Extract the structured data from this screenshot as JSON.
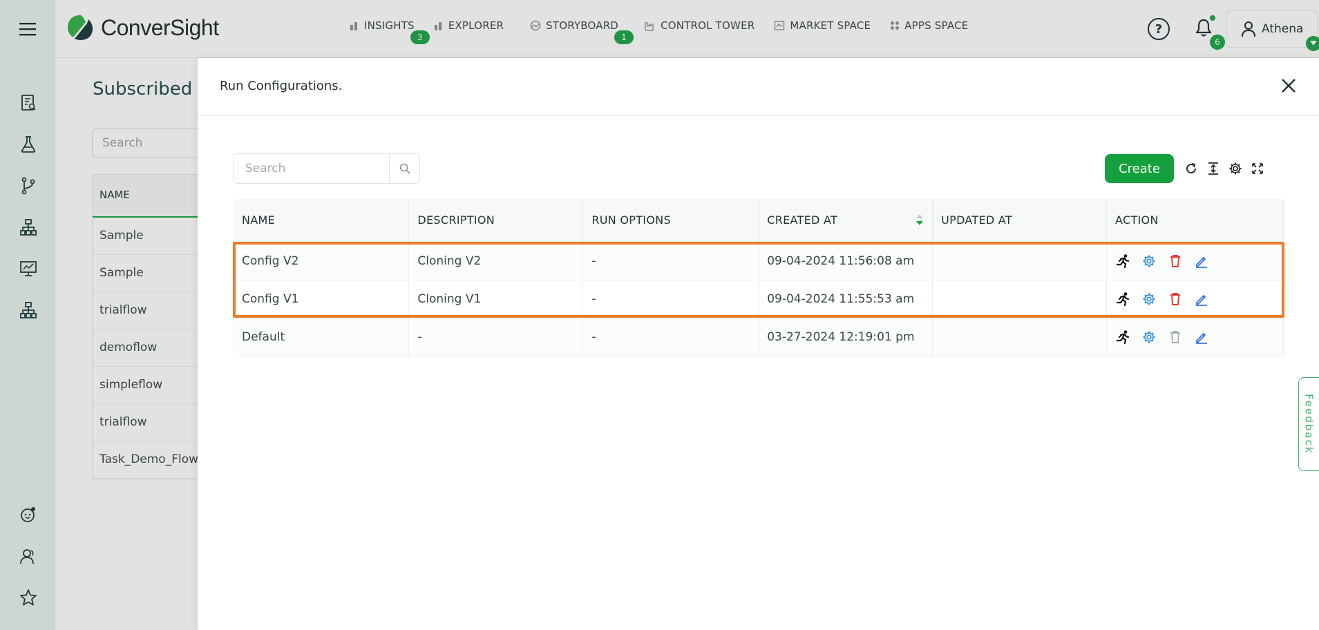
{
  "app": {
    "logo_text": "ConverSight",
    "brand_color": "#1fa34a"
  },
  "nav": {
    "items": [
      {
        "label": "INSIGHTS",
        "icon": "bar-chart-icon",
        "badge": "3"
      },
      {
        "label": "EXPLORER",
        "icon": "bar-chart-icon",
        "badge": ""
      },
      {
        "label": "STORYBOARD",
        "icon": "storyboard-icon",
        "badge": "1"
      },
      {
        "label": "CONTROL TOWER",
        "icon": "factory-icon",
        "badge": ""
      },
      {
        "label": "MARKET SPACE",
        "icon": "market-icon",
        "badge": ""
      },
      {
        "label": "APPS SPACE",
        "icon": "grid-icon",
        "badge": ""
      }
    ]
  },
  "header": {
    "help_label": "?",
    "notification_count": "6",
    "user_name": "Athena"
  },
  "background_page": {
    "title": "Subscribed F",
    "search_placeholder": "Search",
    "column_header": "NAME",
    "rows": [
      "Sample",
      "Sample",
      "trialflow",
      "demoflow",
      "simpleflow",
      "trialflow",
      "Task_Demo_Flow"
    ]
  },
  "drawer": {
    "title": "Run Configurations.",
    "search_placeholder": "Search",
    "create_label": "Create",
    "columns": [
      "NAME",
      "DESCRIPTION",
      "RUN OPTIONS",
      "CREATED AT",
      "UPDATED AT",
      "ACTION"
    ],
    "rows": [
      {
        "name": "Config V2",
        "description": "Cloning V2",
        "run_options": "-",
        "created_at": "09-04-2024 11:56:08 am",
        "updated_at": "",
        "delete_enabled": true
      },
      {
        "name": "Config V1",
        "description": "Cloning V1",
        "run_options": "-",
        "created_at": "09-04-2024 11:55:53 am",
        "updated_at": "",
        "delete_enabled": true
      },
      {
        "name": "Default",
        "description": "-",
        "run_options": "-",
        "created_at": "03-27-2024 12:19:01 pm",
        "updated_at": "",
        "delete_enabled": false
      }
    ],
    "highlight_color": "#f07b2a"
  },
  "feedback": {
    "label": "Feedback"
  }
}
